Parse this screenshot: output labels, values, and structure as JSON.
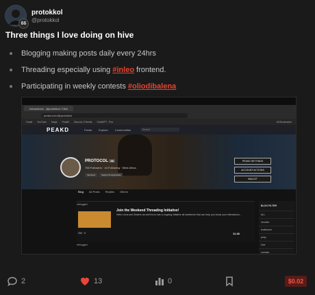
{
  "author": {
    "username": "protokkol",
    "handle": "@protokkol",
    "reputation": "66"
  },
  "post": {
    "title": "Three things I love doing on hive",
    "bullets": [
      {
        "text": "Blogging making posts daily every 24hrs",
        "tag": "",
        "suffix": ""
      },
      {
        "text": "Threading especially using",
        "tag": "#inleo",
        "suffix": "frontend."
      },
      {
        "text": "Participating in weekly contests",
        "tag": "#oliodibalena",
        "suffix": ""
      }
    ]
  },
  "screenshot": {
    "tab_label": "Interactions - @protokkol / Hive",
    "url": "peakd.com/@protokkol",
    "bookmarks": [
      "Gmail",
      "YouTube",
      "Maps",
      "PeakD",
      "Discord | Friends",
      "ChatGPT - Pos",
      "All Bookmarks"
    ],
    "app_logo": "PEAKD",
    "menu": [
      "Feeds",
      "Explore",
      "Communities"
    ],
    "search_placeholder": "Search",
    "profile_name": "PROTOCOL",
    "profile_rep": "66",
    "profile_meta": "766 Followers · 44 Following · West Africa",
    "profile_buttons": [
      "Interview",
      "Support & Appreciate"
    ],
    "side_buttons": [
      "PEAKD SETTINGS",
      "ACCOUNT ACTIONS",
      "WALLET"
    ],
    "nav_tabs": [
      "Blog",
      "All Posts",
      "Replies",
      "Others"
    ],
    "post1": {
      "reblog": "reblogged",
      "title": "Join the Weekend Threading Initiative!",
      "body": "Hello Lions and Zealers as well InLeo has a ongoing initiative all weekends that can help you boost your interactions...",
      "votes": "292",
      "comments": "9",
      "payout": "11.46"
    },
    "post2_reblog": "reblogged",
    "sidebar_title": "BLOG FILTER",
    "sidebar_items": [
      "ALL",
      "neoxian",
      "leofinance",
      "pimp",
      "hive",
      "onchain"
    ]
  },
  "actions": {
    "comments": "2",
    "likes": "13",
    "views": "0",
    "reward": "$0.02"
  },
  "colors": {
    "accent": "#e7432f",
    "like": "#e8463a",
    "reward_bg": "#5a1b17"
  },
  "icons": [
    "comment-icon",
    "heart-icon",
    "bar-chart-icon",
    "bookmark-icon"
  ]
}
